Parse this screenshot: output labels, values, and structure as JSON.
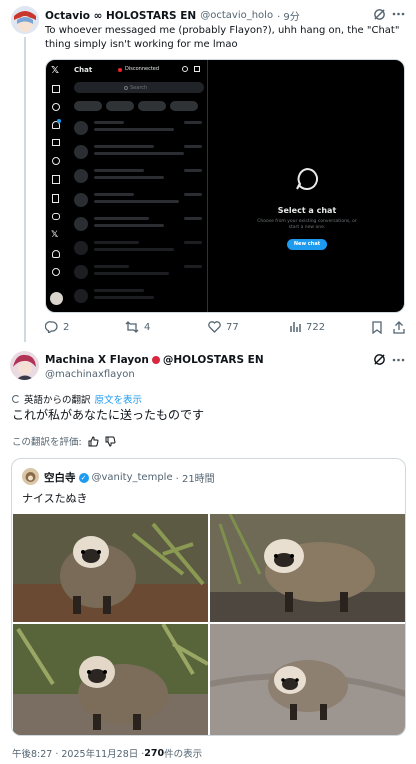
{
  "post1": {
    "display_name": "Octavio ∞ HOLOSTARS EN",
    "handle": "@octavio_holo",
    "time": "· 9分",
    "body": "To whoever messaged me (probably Flayon?), uhh hang on, the \"Chat\" thing simply isn't working for me lmao",
    "stats": {
      "replies": "2",
      "reposts": "4",
      "likes": "77",
      "views": "722"
    },
    "screenshot": {
      "chat_title": "Chat",
      "status": "Disconnected",
      "search_placeholder": "Search",
      "empty_title": "Select a chat",
      "empty_sub": "Choose from your existing conversations, or start a new one.",
      "new_chat": "New chat"
    }
  },
  "post2": {
    "display_name": "Machina X Flayon",
    "display_name_suffix": "@HOLOSTARS EN",
    "handle": "@machinaxflayon",
    "translated_from": "英語からの翻訳",
    "show_original": "原文を表示",
    "body": "これが私があなたに送ったものです",
    "rate_translation": "この翻訳を評価:",
    "quote": {
      "display_name": "空白寺",
      "handle": "@vanity_temple",
      "time": "· 21時間",
      "body": "ナイスたぬき"
    },
    "footer": {
      "timestamp": "午後8:27 · 2025年11月28日 · ",
      "views_count": "270",
      "views_label": " 件の表示"
    }
  },
  "colors": {
    "accent": "#1d9bf0",
    "verified": "#1d9bf0",
    "text": "#0f1419",
    "muted": "#536471"
  }
}
